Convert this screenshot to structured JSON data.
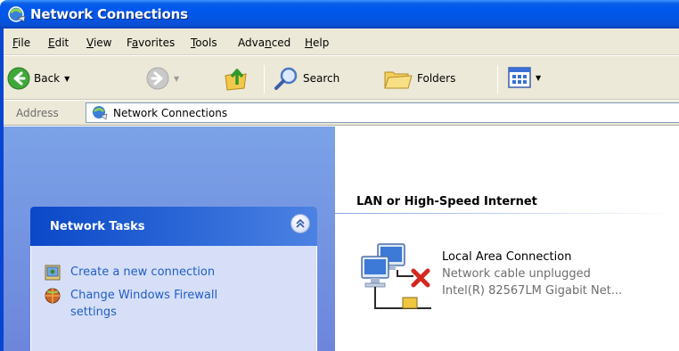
{
  "window": {
    "title": "Network Connections",
    "title_color": "#0058ee"
  },
  "menu": {
    "items": [
      {
        "label": "File",
        "underline": "F",
        "rest": "ile"
      },
      {
        "label": "Edit",
        "underline": "E",
        "rest": "dit"
      },
      {
        "label": "View",
        "underline": "V",
        "rest": "iew"
      },
      {
        "label": "Favorites",
        "pre": "F",
        "underline": "a",
        "rest": "vorites"
      },
      {
        "label": "Tools",
        "underline": "T",
        "rest": "ools"
      },
      {
        "label": "Advanced",
        "pre": "Adva",
        "underline": "n",
        "rest": "ced"
      },
      {
        "label": "Help",
        "underline": "H",
        "rest": "elp"
      }
    ]
  },
  "toolbar": {
    "back_label": "Back",
    "search_label": "Search",
    "folders_label": "Folders"
  },
  "address": {
    "label": "Address",
    "value": "Network Connections"
  },
  "task_pane": {
    "title": "Network Tasks",
    "links": [
      {
        "text": "Create a new connection",
        "icon": "new-connection-icon"
      },
      {
        "text": "Change Windows Firewall settings",
        "line1": "Change Windows Firewall",
        "line2": "settings",
        "icon": "firewall-icon"
      }
    ]
  },
  "content": {
    "group_header": "LAN or High-Speed Internet",
    "connection": {
      "name": "Local Area Connection",
      "status": "Network cable unplugged",
      "device": "Intel(R) 82567LM Gigabit Net..."
    }
  }
}
